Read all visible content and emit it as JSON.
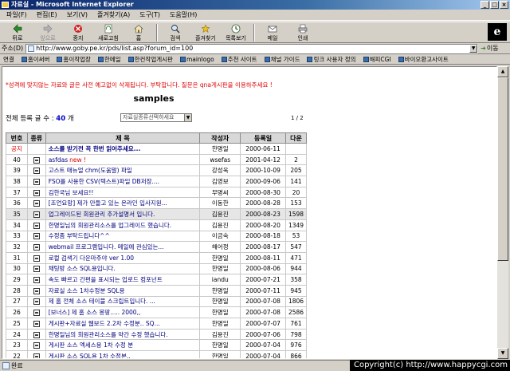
{
  "window": {
    "title": "자료실 - Microsoft Internet Explorer"
  },
  "menu": [
    "파일(F)",
    "편집(E)",
    "보기(V)",
    "즐겨찾기(A)",
    "도구(T)",
    "도움말(H)"
  ],
  "toolbar": {
    "back": "뒤로",
    "forward": "앞으로",
    "stop": "중지",
    "refresh": "새로고침",
    "home": "홈",
    "search": "검색",
    "favorites": "즐겨찾기",
    "history": "목록보기",
    "mail": "메일",
    "print": "인쇄"
  },
  "address": {
    "label": "주소(D)",
    "url": "http://www.goby.pe.kr/pds/list.asp?forum_id=100",
    "go": "이동"
  },
  "links": {
    "label": "연결",
    "items": [
      "홈이써버",
      "홈이작업장",
      "한메일",
      "한컨작업게시판",
      "mainlogo",
      "추천 사이트",
      "채널 가이드",
      "링크 사용자 정의",
      "해피CGI",
      "바이오환고사이트"
    ]
  },
  "page": {
    "notice": "*성격에 맞지않는 자료와 글은 사전 예고없이 삭제됩니다. 부탁합니다. 질문은 qna게시판을 이용하주세요 !",
    "title": "samples",
    "count_label": "전체 등록 글 수 :",
    "count_value": "40",
    "count_unit": "개",
    "category_select": "자료실종류선택하세요",
    "page_indicator": "1 / 2"
  },
  "table": {
    "headers": [
      "번호",
      "종류",
      "제 목",
      "작성자",
      "등록일",
      "다운"
    ],
    "rows": [
      {
        "num": "공지",
        "subject": "소스를 받기전 꼭 한번 읽어주세요...",
        "author": "한명일",
        "date": "2000-06-11",
        "views": "",
        "new": "",
        "has_icon": false
      },
      {
        "num": "40",
        "subject": "asfdas",
        "author": "wsefas",
        "date": "2001-04-12",
        "views": "2",
        "new": "new !",
        "has_icon": true
      },
      {
        "num": "39",
        "subject": "고스트 매뉴얼 chm(도움말) 파일",
        "author": "강성욱",
        "date": "2000-10-09",
        "views": "205",
        "new": "",
        "has_icon": true
      },
      {
        "num": "38",
        "subject": "FSO를 사용한 CSV(텍스트)파일 DB저장....",
        "author": "김영보",
        "date": "2000-09-06",
        "views": "141",
        "new": "",
        "has_icon": true
      },
      {
        "num": "37",
        "subject": "김한국님 보세요!!",
        "author": "무명씨",
        "date": "2000-08-30",
        "views": "20",
        "new": "",
        "has_icon": true
      },
      {
        "num": "36",
        "subject": "[조언요망] 제가 만들고 있는 온라인 입사지원...",
        "author": "이동한",
        "date": "2000-08-28",
        "views": "153",
        "new": "",
        "has_icon": true
      },
      {
        "num": "35",
        "subject": "업그레이드된 회원관리 추가설명서 입니다.",
        "author": "김용진",
        "date": "2000-08-23",
        "views": "1598",
        "new": "",
        "has_icon": true
      },
      {
        "num": "34",
        "subject": "한명일님의 회원관리소스를 업그레이드 했습니다.",
        "author": "김용진",
        "date": "2000-08-20",
        "views": "1349",
        "new": "",
        "has_icon": true
      },
      {
        "num": "33",
        "subject": "수정좀 부탁드립니다^^",
        "author": "이금숙",
        "date": "2000-08-18",
        "views": "53",
        "new": "",
        "has_icon": true
      },
      {
        "num": "32",
        "subject": "webmail 프로그램입니다. 메일에 관심있는...",
        "author": "해어정",
        "date": "2000-08-17",
        "views": "547",
        "new": "",
        "has_icon": true
      },
      {
        "num": "31",
        "subject": "로컬 검색기 다운마주야 ver 1.00",
        "author": "한명일",
        "date": "2000-08-11",
        "views": "471",
        "new": "",
        "has_icon": true
      },
      {
        "num": "30",
        "subject": "채팅방 소스 SQL용입니다.",
        "author": "한명일",
        "date": "2000-08-06",
        "views": "944",
        "new": "",
        "has_icon": true
      },
      {
        "num": "29",
        "subject": "속도 빠르고 간편을 표시되는 업로드 컴포넌트",
        "author": "iandu",
        "date": "2000-07-21",
        "views": "358",
        "new": "",
        "has_icon": true
      },
      {
        "num": "28",
        "subject": "자료실 소스 1차수정분 SQL용",
        "author": "한명일",
        "date": "2000-07-11",
        "views": "945",
        "new": "",
        "has_icon": true
      },
      {
        "num": "27",
        "subject": "제 홈 전체 소스 테이블 스크립트입니다. ...",
        "author": "한명일",
        "date": "2000-07-08",
        "views": "1806",
        "new": "",
        "has_icon": true
      },
      {
        "num": "26",
        "subject": "[보너스] 제 홈 소스 몽땅..... 2000,,",
        "author": "한명일",
        "date": "2000-07-08",
        "views": "2586",
        "new": "",
        "has_icon": true
      },
      {
        "num": "25",
        "subject": "게시판+자료실 웹보드 2.2차 수정분.. SQ...",
        "author": "한명일",
        "date": "2000-07-07",
        "views": "761",
        "new": "",
        "has_icon": true
      },
      {
        "num": "24",
        "subject": "한명일님의 회원관리소스를 약간 수정 했습니다.",
        "author": "김용진",
        "date": "2000-07-06",
        "views": "798",
        "new": "",
        "has_icon": true
      },
      {
        "num": "23",
        "subject": "게시판 소스 엑세스용 1차 수정 분",
        "author": "한명일",
        "date": "2000-07-04",
        "views": "976",
        "new": "",
        "has_icon": true
      },
      {
        "num": "22",
        "subject": "게시판 소스 SQL용 1차 수정분..",
        "author": "한명일",
        "date": "2000-07-04",
        "views": "866",
        "new": "",
        "has_icon": true
      }
    ]
  },
  "status": {
    "text": "완료"
  },
  "watermark": "Copyright(c) http://www.happycgi.com"
}
